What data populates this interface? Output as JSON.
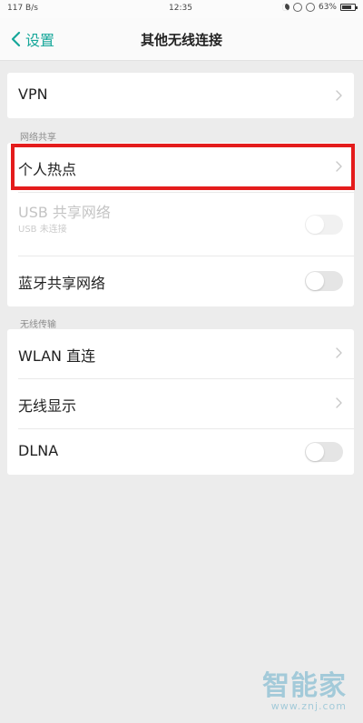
{
  "status_bar": {
    "signal_text": "117 B/s",
    "time": "12:35",
    "battery": "63%"
  },
  "header": {
    "back_label": "设置",
    "title": "其他无线连接"
  },
  "sections": {
    "network_share_header": "网络共享",
    "wireless_transfer_header": "无线传输"
  },
  "rows": {
    "vpn": "VPN",
    "personal_hotspot": "个人热点",
    "usb_share": {
      "label": "USB 共享网络",
      "subtitle": "USB 未连接"
    },
    "bluetooth_share": "蓝牙共享网络",
    "wlan_direct": "WLAN 直连",
    "wireless_display": "无线显示",
    "dlna": "DLNA"
  },
  "toggles": {
    "usb_share": false,
    "bluetooth_share": false,
    "dlna": false
  },
  "watermark": {
    "brand": "智能家",
    "url": "www.znj.com"
  },
  "colors": {
    "accent": "#17a79a",
    "highlight": "#e41c1c",
    "background": "#ececec",
    "watermark": "#8bbfd3"
  },
  "icons": {
    "back": "chevron-left-icon",
    "row_navigation": "chevron-right-icon",
    "status_do_not_disturb": "moon-icon",
    "status_battery": "battery-icon"
  }
}
